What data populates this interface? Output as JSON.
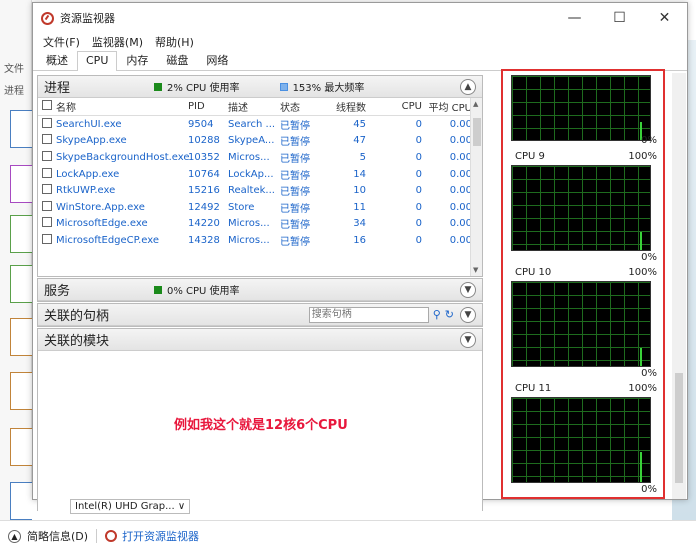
{
  "window": {
    "title": "资源监视器",
    "controls": [
      "—",
      "☐",
      "✕"
    ]
  },
  "menu": [
    "文件(F)",
    "监视器(M)",
    "帮助(H)"
  ],
  "tabs": [
    {
      "label": "概述",
      "active": false
    },
    {
      "label": "CPU",
      "active": true
    },
    {
      "label": "内存",
      "active": false
    },
    {
      "label": "磁盘",
      "active": false
    },
    {
      "label": "网络",
      "active": false
    }
  ],
  "process_section": {
    "title": "进程",
    "cpu_usage": "2% CPU 使用率",
    "max_freq": "153% 最大频率",
    "usage_color": "#1b8a1b",
    "freq_color": "#4a90e2",
    "columns": [
      "名称",
      "PID",
      "描述",
      "状态",
      "线程数",
      "CPU",
      "平均 CPU"
    ],
    "rows": [
      [
        "SearchUI.exe",
        "9504",
        "Search ...",
        "已暂停",
        "45",
        "0",
        "0.00"
      ],
      [
        "SkypeApp.exe",
        "10288",
        "SkypeA...",
        "已暂停",
        "47",
        "0",
        "0.00"
      ],
      [
        "SkypeBackgroundHost.exe",
        "10352",
        "Micros...",
        "已暂停",
        "5",
        "0",
        "0.00"
      ],
      [
        "LockApp.exe",
        "10764",
        "LockAp...",
        "已暂停",
        "14",
        "0",
        "0.00"
      ],
      [
        "RtkUWP.exe",
        "15216",
        "Realtek...",
        "已暂停",
        "10",
        "0",
        "0.00"
      ],
      [
        "WinStore.App.exe",
        "12492",
        "Store",
        "已暂停",
        "11",
        "0",
        "0.00"
      ],
      [
        "MicrosoftEdge.exe",
        "14220",
        "Micros...",
        "已暂停",
        "34",
        "0",
        "0.00"
      ],
      [
        "MicrosoftEdgeCP.exe",
        "14328",
        "Micros...",
        "已暂停",
        "16",
        "0",
        "0.00"
      ]
    ]
  },
  "services_section": {
    "title": "服务",
    "cpu_usage": "0% CPU 使用率"
  },
  "handles_section": {
    "title": "关联的句柄",
    "search_placeholder": "搜索句柄"
  },
  "modules_section": {
    "title": "关联的模块"
  },
  "annotation": "例如我这个就是12核6个CPU",
  "cpu_graphs": [
    {
      "label": "",
      "max": "",
      "min": "0%"
    },
    {
      "label": "CPU 9",
      "max": "100%",
      "min": "0%"
    },
    {
      "label": "CPU 10",
      "max": "100%",
      "min": "0%"
    },
    {
      "label": "CPU 11",
      "max": "100%",
      "min": "0%"
    }
  ],
  "background": {
    "left_frag_1": "进程",
    "left_frag_2": "文件",
    "gpu_select": "Intel(R) UHD Grap... ∨",
    "bottom_brief": "简略信息(D)",
    "bottom_link": "打开资源监视器"
  }
}
